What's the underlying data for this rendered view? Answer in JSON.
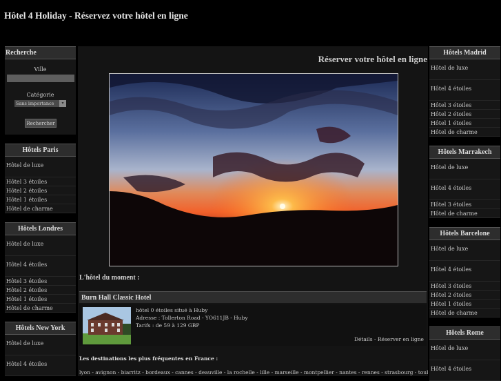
{
  "header": {
    "title": "Hôtel 4 Holiday - Réservez votre hôtel en ligne"
  },
  "search": {
    "title": "Recherche",
    "city_label": "Ville",
    "city_value": "",
    "category_label": "Catégorie",
    "category_selected": "Sans importance",
    "submit_label": "Rechercher"
  },
  "left_boxes": [
    {
      "title": "Hôtels Paris",
      "items": [
        "Hôtel de luxe",
        "Hôtel 3 étoiles",
        "Hôtel 2 étoiles",
        "Hôtel 1 étoiles",
        "Hôtel de charme"
      ]
    },
    {
      "title": "Hôtels Londres",
      "items": [
        "Hôtel de luxe",
        "Hôtel 4 étoiles",
        "Hôtel 3 étoiles",
        "Hôtel 2 étoiles",
        "Hôtel 1 étoiles",
        "Hôtel de charme"
      ]
    },
    {
      "title": "Hôtels New York",
      "items": [
        "Hôtel de luxe",
        "Hôtel 4 étoiles"
      ]
    }
  ],
  "right_boxes": [
    {
      "title": "Hôtels Madrid",
      "items": [
        "Hôtel de luxe",
        "Hôtel 4 étoiles",
        "Hôtel 3 étoiles",
        "Hôtel 2 étoiles",
        "Hôtel 1 étoiles",
        "Hôtel de charme"
      ]
    },
    {
      "title": "Hôtels Marrakech",
      "items": [
        "Hôtel de luxe",
        "Hôtel 4 étoiles",
        "Hôtel 3 étoiles",
        "Hôtel de charme"
      ]
    },
    {
      "title": "Hôtels Barcelone",
      "items": [
        "Hôtel de luxe",
        "Hôtel 4 étoiles",
        "Hôtel 3 étoiles",
        "Hôtel 2 étoiles",
        "Hôtel 1 étoiles",
        "Hôtel de charme"
      ]
    },
    {
      "title": "Hôtels Rome",
      "items": [
        "Hôtel de luxe",
        "Hôtel 4 étoiles"
      ]
    }
  ],
  "main": {
    "title": "Réserver votre hôtel en ligne",
    "moment_title": "L'hôtel du moment :",
    "hotel": {
      "name": "Burn Hall Classic Hotel",
      "line1": "hôtel 0 étoiles situé à Huby",
      "line2": "Adresse : Tollerton Road - YO611JB - Huby",
      "line3": "Tarifs : de 59 à 129 GBP",
      "details_label": "Détails",
      "separator": " - ",
      "book_label": "Réserver en ligne"
    },
    "destinations_title": "Les destinations les plus fréquentes en France :",
    "destinations": "lyon - avignon - biarritz - bordeaux - cannes - deauville - la rochelle - lille - marseille - montpellier - nantes - rennes - strasbourg - toulouse - tours - annecy"
  }
}
